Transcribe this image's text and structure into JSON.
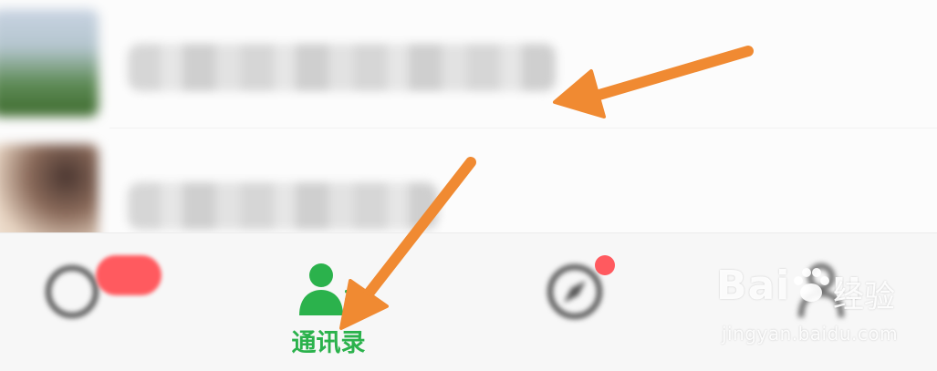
{
  "tabbar": {
    "tabs": [
      {
        "id": "chats",
        "label": "",
        "icon": "chat-bubbles-icon",
        "active": false,
        "has_badge": true
      },
      {
        "id": "contacts",
        "label": "通讯录",
        "icon": "contacts-icon",
        "active": true
      },
      {
        "id": "discover",
        "label": "",
        "icon": "compass-icon",
        "active": false,
        "has_dot": true
      },
      {
        "id": "me",
        "label": "",
        "icon": "person-icon",
        "active": false
      }
    ],
    "active_color": "#2bb24c",
    "badge_color": "#ff5a5f"
  },
  "annotations": {
    "arrow_color": "#f08a32"
  },
  "watermark": {
    "logo_text": "Bai",
    "logo_text_2": "u",
    "subtitle": "经验",
    "url": "jingyan.baidu.com"
  }
}
